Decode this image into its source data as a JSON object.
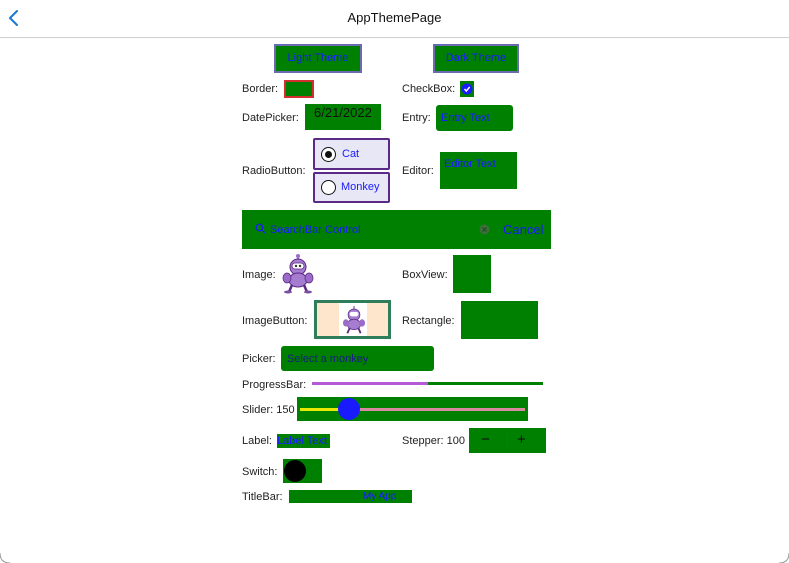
{
  "nav": {
    "title": "AppThemePage",
    "back_icon": "chevron-left-icon"
  },
  "buttons": {
    "light": "Light Theme",
    "dark": "Dark Theme"
  },
  "labels": {
    "border": "Border:",
    "checkbox": "CheckBox:",
    "datepicker": "DatePicker:",
    "entry": "Entry:",
    "radiobutton": "RadioButton:",
    "editor": "Editor:",
    "image": "Image:",
    "boxview": "BoxView:",
    "imagebutton": "ImageButton:",
    "rectangle": "Rectangle:",
    "picker": "Picker:",
    "progressbar": "ProgressBar:",
    "slider": "Slider: 150",
    "label": "Label:",
    "stepper": "Stepper: 100",
    "switch": "Switch:",
    "titlebar": "TitleBar:"
  },
  "values": {
    "date": "6/21/2022",
    "entry_text": "Entry Text",
    "editor_text": "Editor Text",
    "radio_cat": "Cat",
    "radio_monkey": "Monkey",
    "search_placeholder": "SearchBar Control",
    "cancel": "Cancel",
    "picker_placeholder": "Select a monkey",
    "label_text": "Label Text",
    "stepper_minus": "−",
    "stepper_plus": "+",
    "titlebar_text": "My App"
  },
  "state": {
    "checkbox_checked": true,
    "radio_selected": "Cat",
    "progress": 0.5,
    "slider_value": 150,
    "switch_on": false
  },
  "colors": {
    "accent": "#008000",
    "text_blue": "#1a1aff",
    "purple": "#5b2a86",
    "progress": "#b45ad6"
  }
}
